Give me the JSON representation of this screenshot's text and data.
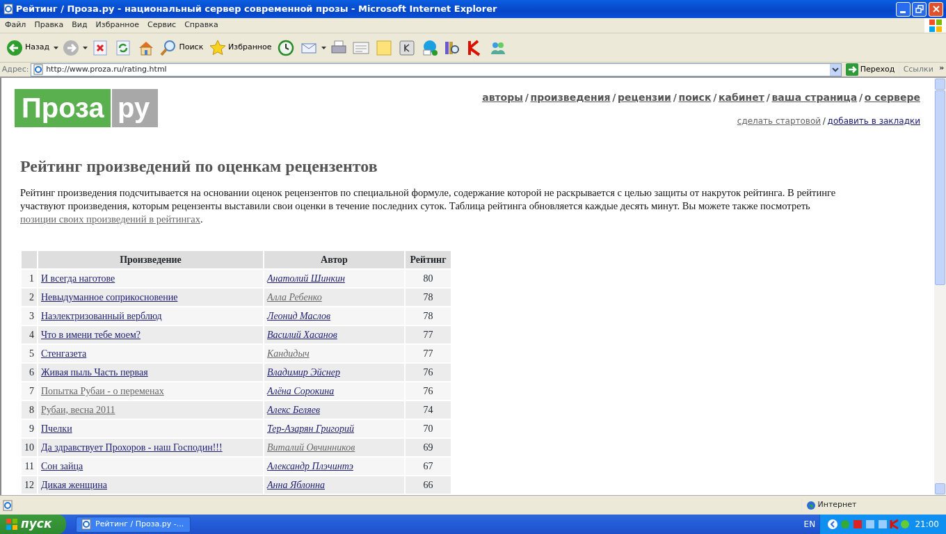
{
  "window": {
    "title": "Рейтинг / Проза.ру - национальный сервер современной прозы - Microsoft Internet Explorer"
  },
  "menu": [
    "Файл",
    "Правка",
    "Вид",
    "Избранное",
    "Сервис",
    "Справка"
  ],
  "toolbar": [
    {
      "kind": "back",
      "label": "Назад"
    },
    {
      "kind": "forward"
    },
    {
      "kind": "stop"
    },
    {
      "kind": "refresh"
    },
    {
      "kind": "home"
    },
    {
      "kind": "search",
      "label": "Поиск"
    },
    {
      "kind": "favorites",
      "label": "Избранное"
    },
    {
      "kind": "history"
    },
    {
      "kind": "mail"
    },
    {
      "kind": "print"
    },
    {
      "kind": "edit"
    },
    {
      "kind": "note"
    },
    {
      "kind": "k"
    },
    {
      "kind": "skype"
    },
    {
      "kind": "research"
    },
    {
      "kind": "kaspersky"
    },
    {
      "kind": "messenger"
    }
  ],
  "address_bar": {
    "label": "Адрес:",
    "url": "http://www.proza.ru/rating.html",
    "go": "Переход",
    "links": "Ссылки",
    "more": "»"
  },
  "page": {
    "logo": [
      "Проза",
      "ру"
    ],
    "nav": [
      "авторы",
      "произведения",
      "рецензии",
      "поиск",
      "кабинет",
      "ваша страница",
      "о сервере"
    ],
    "nav_separators": [
      "/",
      "/",
      "/",
      "/",
      "/",
      "/"
    ],
    "secondary_separators": [
      "/"
    ],
    "secondary_links": [
      {
        "text": "сделать стартовой",
        "visited": true
      },
      {
        "text": "добавить в закладки",
        "visited": false
      }
    ],
    "heading": "Рейтинг произведений по оценкам рецензентов",
    "intro": {
      "text": "Рейтинг произведения подсчитывается на основании оценок рецензентов по специальной формуле, содержание которой не раскрывается с целью защиты от накруток рейтинга. В рейтинге участвуют произведения, которым рецензенты выставили свои оценки в течение последних суток. Таблица рейтинга обновляется каждые десять минут. Вы можете также посмотреть ",
      "link": "позиции своих произведений в рейтингах",
      "after": "."
    },
    "table": {
      "columns": [
        "Произведение",
        "Автор",
        "Рейтинг"
      ],
      "rows": [
        {
          "rank": "1",
          "title": "И всегда наготове",
          "title_visited": false,
          "author": "Анатолий Шинкин",
          "author_visited": false,
          "rating": "80"
        },
        {
          "rank": "2",
          "title": "Невыдуманное соприкосновение",
          "title_visited": false,
          "author": "Алла Ребенко",
          "author_visited": true,
          "rating": "78"
        },
        {
          "rank": "3",
          "title": "Наэлектризованный верблюд",
          "title_visited": false,
          "author": "Леонид Маслов",
          "author_visited": false,
          "rating": "78"
        },
        {
          "rank": "4",
          "title": "Что в имени тебе моем?",
          "title_visited": false,
          "author": "Василий Хасанов",
          "author_visited": false,
          "rating": "77"
        },
        {
          "rank": "5",
          "title": "Стенгазета",
          "title_visited": false,
          "author": "Кандидыч",
          "author_visited": true,
          "rating": "77"
        },
        {
          "rank": "6",
          "title": "Живая пыль Часть первая",
          "title_visited": false,
          "author": "Владимир Эйснер",
          "author_visited": false,
          "rating": "76"
        },
        {
          "rank": "7",
          "title": "Попытка Рубаи - о переменах",
          "title_visited": true,
          "author": "Алёна Сорокина",
          "author_visited": false,
          "rating": "76"
        },
        {
          "rank": "8",
          "title": "Рубаи, весна 2011",
          "title_visited": true,
          "author": "Алекс Беляев",
          "author_visited": false,
          "rating": "74"
        },
        {
          "rank": "9",
          "title": "Пчелки",
          "title_visited": false,
          "author": "Тер-Азарян Григорий",
          "author_visited": false,
          "rating": "70"
        },
        {
          "rank": "10",
          "title": "Да здравствует Прохоров - наш Господин!!!",
          "title_visited": false,
          "author": "Виталий Овчинников",
          "author_visited": true,
          "rating": "69"
        },
        {
          "rank": "11",
          "title": "Сон зайца",
          "title_visited": false,
          "author": "Александр Плэчинтэ",
          "author_visited": false,
          "rating": "67"
        },
        {
          "rank": "12",
          "title": "Дикая женщина",
          "title_visited": false,
          "author": "Анна Яблонна",
          "author_visited": false,
          "rating": "66"
        }
      ]
    }
  },
  "status_bar": {
    "zone": "Интернет"
  },
  "taskbar": {
    "start": "пуск",
    "task": "Рейтинг / Проза.ру -...",
    "language": "EN",
    "clock": "21:00"
  }
}
